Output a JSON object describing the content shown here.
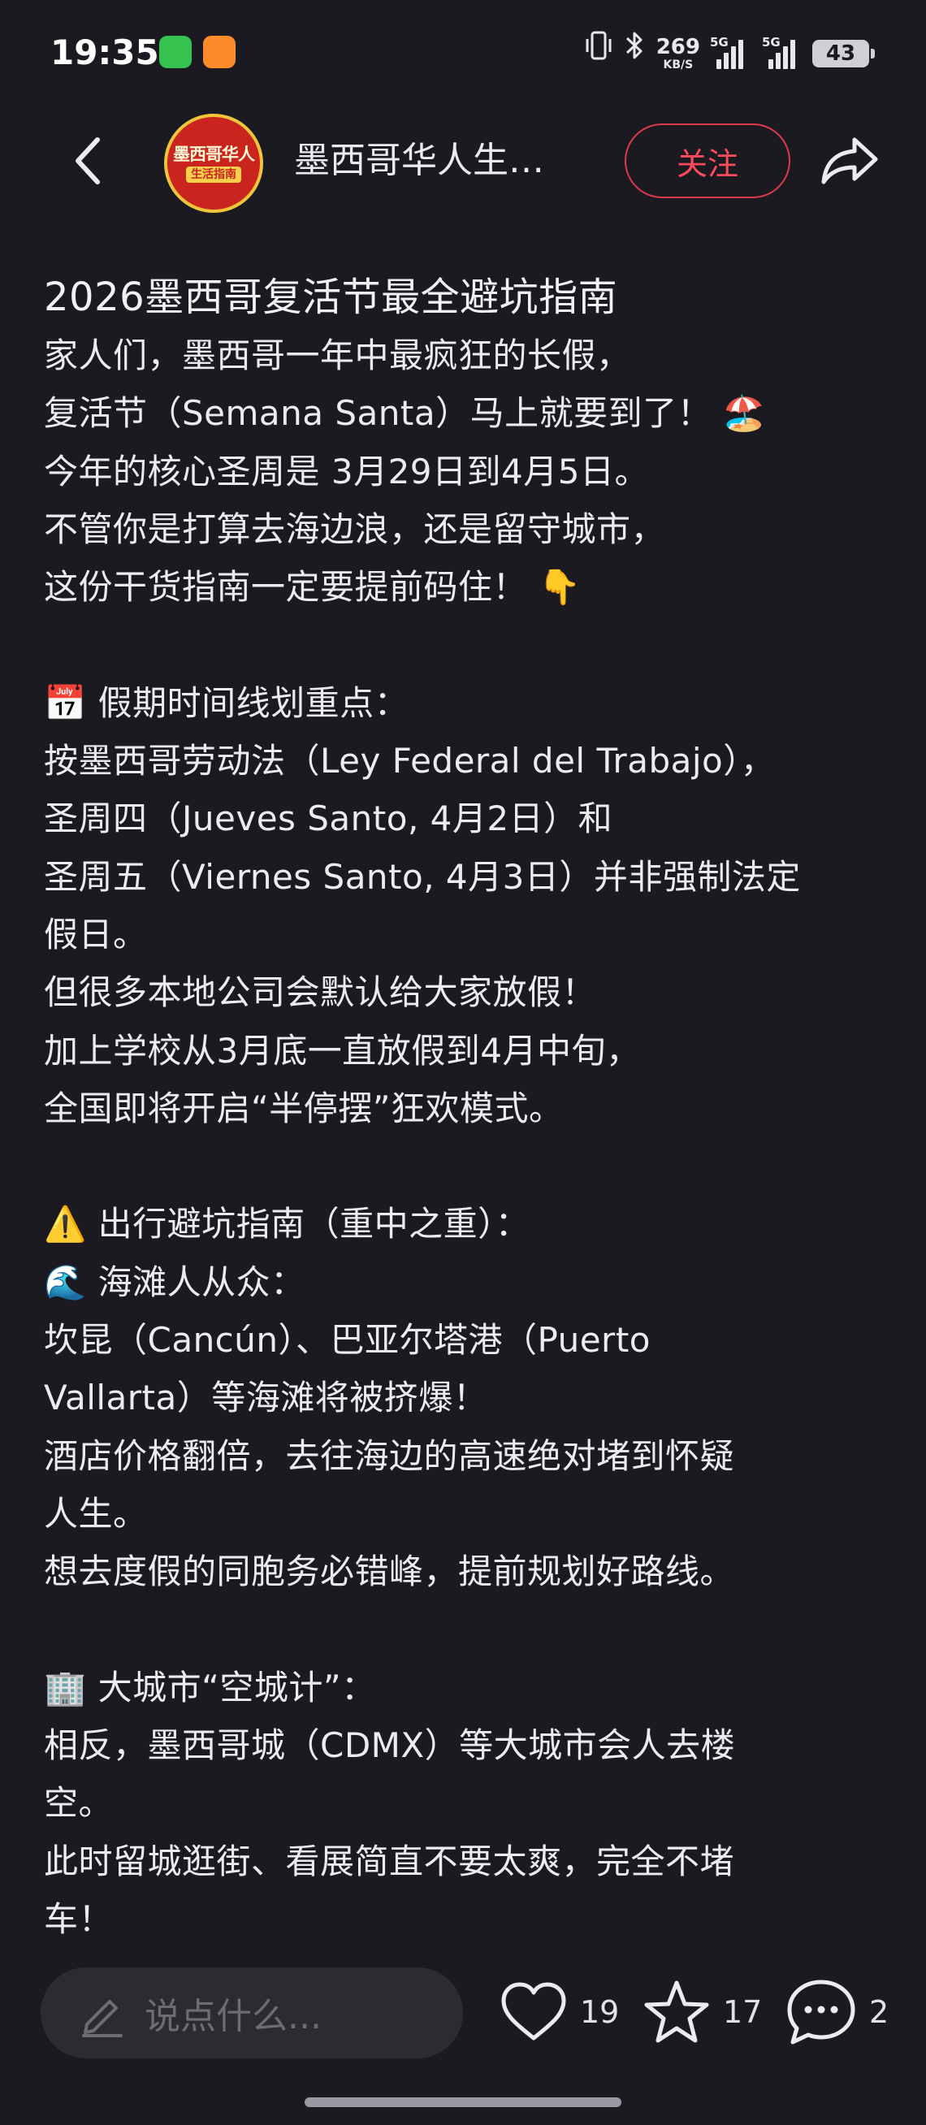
{
  "status_bar": {
    "time": "19:35",
    "net_speed": "269",
    "net_unit": "KB/S",
    "signal1_label": "5G",
    "signal2_label": "5G",
    "battery": "43",
    "icons": [
      "vibrate-icon",
      "bluetooth-icon"
    ]
  },
  "header": {
    "back_icon": "chevron-left-icon",
    "avatar_text_line1": "墨西哥华人",
    "avatar_text_line2": "生活指南",
    "author_name": "墨西哥华人生…",
    "follow_label": "关注",
    "share_icon": "share-arrow-icon"
  },
  "post": {
    "title": "2026墨西哥复活节最全避坑指南",
    "lines": [
      "家人们，墨西哥一年中最疯狂的长假，",
      "复活节（Semana Santa）马上就要到了！ 🏖️",
      "今年的核心圣周是 3月29日到4月5日。",
      "不管你是打算去海边浪，还是留守城市，",
      "这份干货指南一定要提前码住！ 👇",
      "",
      "📅 假期时间线划重点：",
      "按墨西哥劳动法（Ley Federal del Trabajo），",
      "圣周四（Jueves Santo, 4月2日）和",
      "圣周五（Viernes Santo, 4月3日）并非强制法定",
      "假日。",
      "但很多本地公司会默认给大家放假！",
      "加上学校从3月底一直放假到4月中旬，",
      "全国即将开启“半停摆”狂欢模式。",
      "",
      "⚠️ 出行避坑指南（重中之重）：",
      "🌊 海滩人从众：",
      "坎昆（Cancún）、巴亚尔塔港（Puerto",
      "Vallarta）等海滩将被挤爆！",
      "酒店价格翻倍，去往海边的高速绝对堵到怀疑",
      "人生。",
      "想去度假的同胞务必错峰，提前规划好路线。",
      "",
      "🏢 大城市“空城计”：",
      "相反，墨西哥城（CDMX）等大城市会人去楼",
      "空。",
      "此时留城逛街、看展简直不要太爽，完全不堵",
      "车！"
    ]
  },
  "bottom_bar": {
    "comment_placeholder": "说点什么...",
    "like_count": "19",
    "star_count": "17",
    "comment_count": "2"
  }
}
